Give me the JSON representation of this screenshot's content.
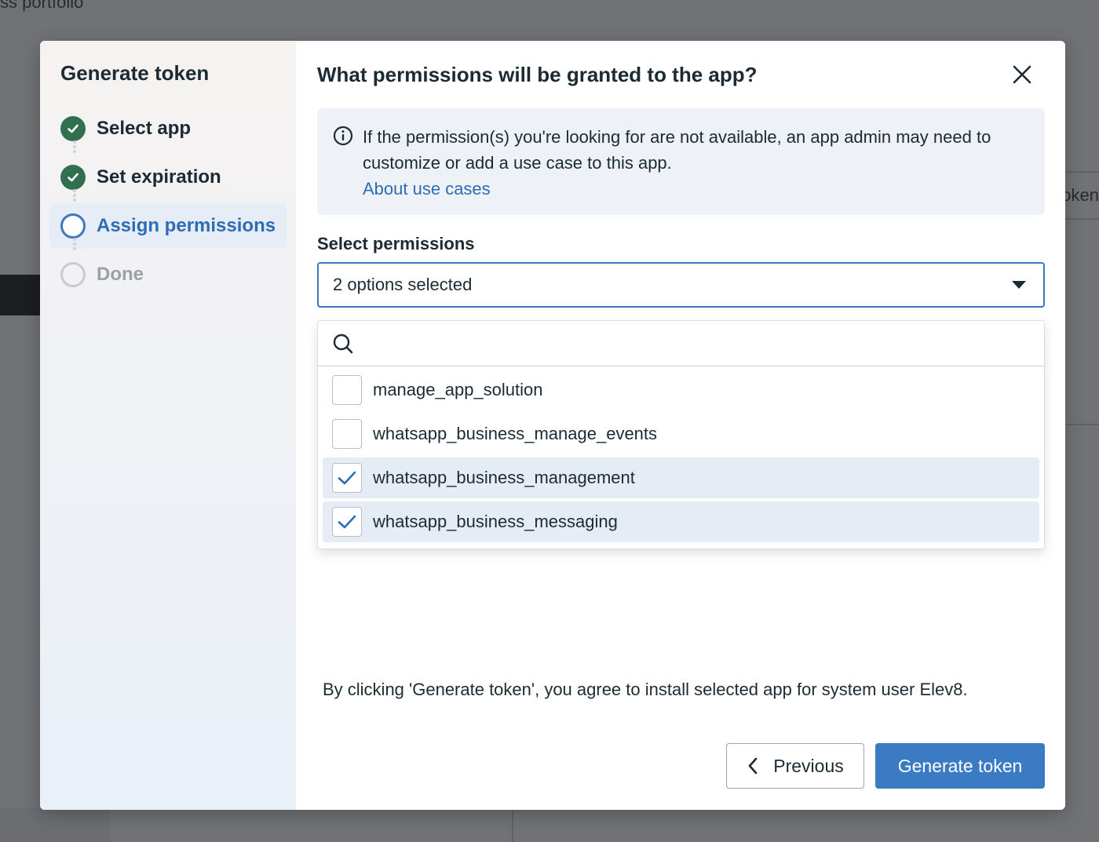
{
  "background": {
    "breadcrumb_fragment": "ss portfolio",
    "right_fragment": "oken"
  },
  "sidebar": {
    "title": "Generate token",
    "steps": [
      {
        "label": "Select app",
        "status": "complete"
      },
      {
        "label": "Set expiration",
        "status": "complete"
      },
      {
        "label": "Assign permissions",
        "status": "current"
      },
      {
        "label": "Done",
        "status": "todo"
      }
    ]
  },
  "main": {
    "title": "What permissions will be granted to the app?",
    "info": {
      "text": "If the permission(s) you're looking for are not available, an app admin may need to customize or add a use case to this app.",
      "link": "About use cases"
    },
    "permissions": {
      "label": "Select permissions",
      "selected_text": "2 options selected",
      "search_placeholder": "",
      "options": [
        {
          "label": "manage_app_solution",
          "checked": false
        },
        {
          "label": "whatsapp_business_manage_events",
          "checked": false
        },
        {
          "label": "whatsapp_business_management",
          "checked": true
        },
        {
          "label": "whatsapp_business_messaging",
          "checked": true
        }
      ]
    },
    "disclaimer": "By clicking 'Generate token', you agree to install selected app for system user Elev8.",
    "buttons": {
      "previous": "Previous",
      "generate": "Generate token"
    }
  },
  "colors": {
    "primary": "#3a7bc3",
    "link": "#2d6db5",
    "success": "#31704f",
    "text": "#1c2b33"
  }
}
